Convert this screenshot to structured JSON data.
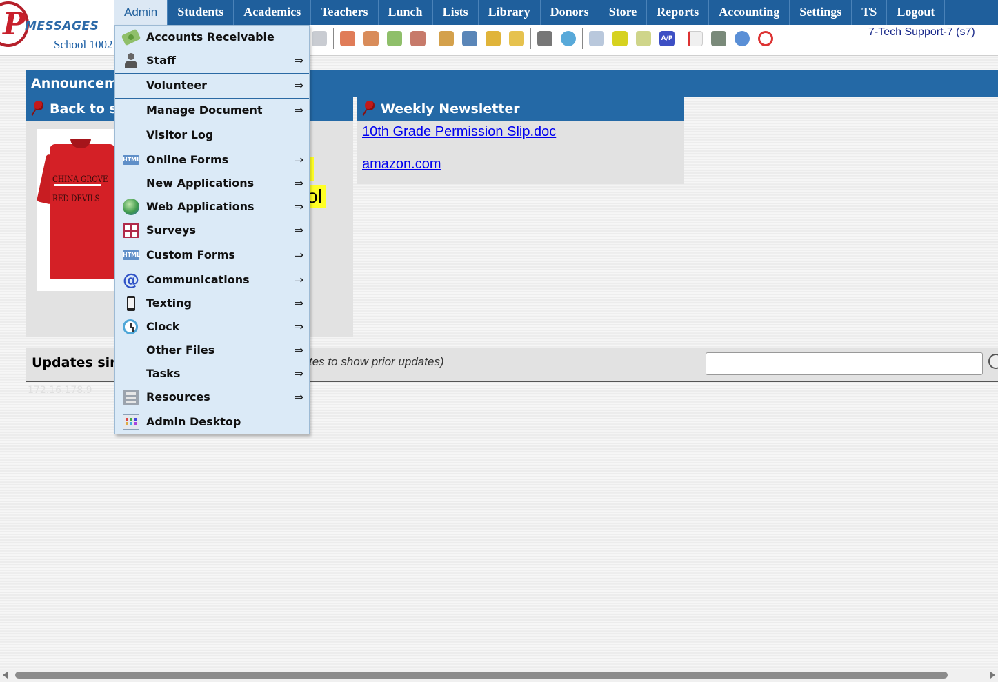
{
  "header": {
    "logo_word": "MESSAGES",
    "logo_letter": "P",
    "school": "School 1002",
    "user": "7-Tech Support-7 (s7)"
  },
  "nav": {
    "items": [
      "Admin",
      "Students",
      "Academics",
      "Teachers",
      "Lunch",
      "Lists",
      "Library",
      "Donors",
      "Store",
      "Reports",
      "Accounting",
      "Settings",
      "TS",
      "Logout"
    ],
    "active": "Admin"
  },
  "toolbar": {
    "icons": [
      "megaphone-icon",
      "add-student-icon",
      "student-icon",
      "money-icon",
      "group-icon",
      "lunch-icon",
      "book-icon",
      "broom-icon",
      "export-icon",
      "staff-icon",
      "clock-icon",
      "table-icon",
      "card-icon",
      "printer-icon",
      "ap-icon",
      "pdf-icon",
      "cash-register-icon",
      "help-icon",
      "stop-icon"
    ],
    "ap_label": "A/P"
  },
  "announcements": {
    "title": "Announcements",
    "back_to_school": {
      "title": "Back to school",
      "shirt_text_1": "CHINA GROVE",
      "shirt_text_2": "RED DEVILS",
      "hl_fragment_1": ")",
      "hl_fragment_2": "ol"
    },
    "newsletter": {
      "title": "Weekly Newsletter",
      "links": [
        "10th Grade Permission Slip.doc",
        "amazon.com"
      ]
    }
  },
  "updates": {
    "title": "Updates since",
    "hint": "tes to show prior updates)",
    "search_value": "",
    "ip_text": "172.16.178.9"
  },
  "admin_menu": {
    "items": [
      {
        "label": "Accounts Receivable",
        "icon": "money-icon",
        "arrow": false,
        "sep": false
      },
      {
        "label": "Staff",
        "icon": "staff-icon",
        "arrow": true,
        "sep": true
      },
      {
        "label": "Volunteer",
        "icon": "",
        "arrow": true,
        "sep": true
      },
      {
        "label": "Manage Document",
        "icon": "",
        "arrow": true,
        "sep": true
      },
      {
        "label": "Visitor Log",
        "icon": "",
        "arrow": false,
        "sep": true
      },
      {
        "label": "Online Forms",
        "icon": "html-icon",
        "arrow": true,
        "sep": false
      },
      {
        "label": "New Applications",
        "icon": "",
        "arrow": true,
        "sep": false
      },
      {
        "label": "Web Applications",
        "icon": "globe-icon",
        "arrow": true,
        "sep": false
      },
      {
        "label": "Surveys",
        "icon": "survey-icon",
        "arrow": true,
        "sep": true
      },
      {
        "label": "Custom Forms",
        "icon": "html-icon",
        "arrow": true,
        "sep": true
      },
      {
        "label": "Communications",
        "icon": "at-icon",
        "arrow": true,
        "sep": false
      },
      {
        "label": "Texting",
        "icon": "phone-icon",
        "arrow": true,
        "sep": false
      },
      {
        "label": "Clock",
        "icon": "clock-icon",
        "arrow": true,
        "sep": false
      },
      {
        "label": "Other Files",
        "icon": "",
        "arrow": true,
        "sep": false
      },
      {
        "label": "Tasks",
        "icon": "",
        "arrow": true,
        "sep": false
      },
      {
        "label": "Resources",
        "icon": "files-icon",
        "arrow": true,
        "sep": true
      },
      {
        "label": "Admin Desktop",
        "icon": "desktop-icon",
        "arrow": false,
        "sep": false
      }
    ],
    "arrow_glyph": "⇒",
    "html_badge": "HTML"
  },
  "colors": {
    "nav_bg": "#1f5f9c",
    "panel_head": "#2469a6",
    "menu_bg": "#dbeaf7",
    "highlight": "#ffff26"
  }
}
